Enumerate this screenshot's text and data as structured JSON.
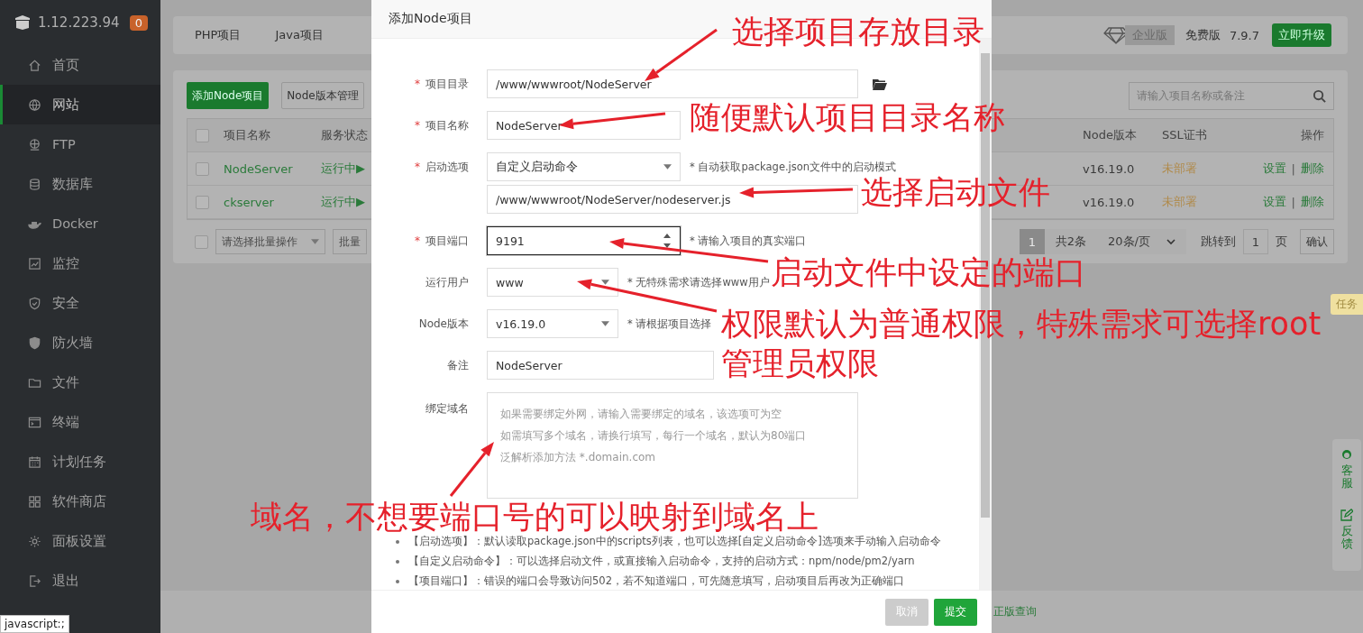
{
  "sidebar": {
    "host": "1.12.223.94",
    "badge": "0",
    "items": [
      {
        "label": "首页",
        "selected": false
      },
      {
        "label": "网站",
        "selected": true
      },
      {
        "label": "FTP",
        "selected": false
      },
      {
        "label": "数据库",
        "selected": false
      },
      {
        "label": "Docker",
        "selected": false
      },
      {
        "label": "监控",
        "selected": false
      },
      {
        "label": "安全",
        "selected": false
      },
      {
        "label": "防火墙",
        "selected": false
      },
      {
        "label": "文件",
        "selected": false
      },
      {
        "label": "终端",
        "selected": false
      },
      {
        "label": "计划任务",
        "selected": false
      },
      {
        "label": "软件商店",
        "selected": false
      },
      {
        "label": "面板设置",
        "selected": false
      },
      {
        "label": "退出",
        "selected": false
      }
    ]
  },
  "tabs": [
    {
      "label": "PHP项目",
      "selected": false
    },
    {
      "label": "Java项目",
      "selected": false
    }
  ],
  "edition": {
    "badge": "企业版",
    "plan": "免费版",
    "version": "7.9.7",
    "upgrade": "立即升级"
  },
  "toolbar": {
    "add": "添加Node项目",
    "manager": "Node版本管理",
    "search_placeholder": "请输入项目名称或备注"
  },
  "table": {
    "header_checked": false,
    "columns_left": [
      "项目名称",
      "服务状态"
    ],
    "columns_right": [
      "Node版本",
      "SSL证书",
      "操作"
    ],
    "rows": [
      {
        "checked": false,
        "name": "NodeServer",
        "status": "运行中▶",
        "version": "v16.19.0",
        "ssl": "未部署",
        "actions": [
          "设置",
          "|",
          "删除"
        ]
      },
      {
        "checked": false,
        "name": "ckserver",
        "status": "运行中▶",
        "version": "v16.19.0",
        "ssl": "未部署",
        "actions": [
          "设置",
          "|",
          "删除"
        ]
      }
    ]
  },
  "batch": {
    "checked": false,
    "select_placeholder": "请选择批量操作",
    "button": "批量"
  },
  "pagination": {
    "current": "1",
    "total": "共2条",
    "page_size": "20条/页",
    "jump_label": "跳转到",
    "jump_value": "1",
    "page_unit": "页",
    "confirm": "确认"
  },
  "float_panel": {
    "task": "任务",
    "items": [
      "客服",
      "反馈"
    ]
  },
  "footer_link": "正版查询",
  "status_tooltip": "javascript:;",
  "modal": {
    "title": "添加Node项目",
    "fields": [
      {
        "kind": "path",
        "required_mark": "*",
        "label": "项目目录",
        "value": "/www/wwwroot/NodeServer"
      },
      {
        "kind": "text",
        "required_mark": "*",
        "label": "项目名称",
        "value": "NodeServer"
      },
      {
        "kind": "select",
        "required_mark": "*",
        "label": "启动选项",
        "value": "自定义启动命令",
        "hint": "* 自动获取package.json文件中的启动模式"
      },
      {
        "kind": "text",
        "value": "/www/wwwroot/NodeServer/nodeserver.js"
      },
      {
        "kind": "number",
        "required_mark": "*",
        "label": "项目端口",
        "value": "9191",
        "focused": true,
        "hint": "* 请输入项目的真实端口"
      },
      {
        "kind": "select",
        "label": "运行用户",
        "value": "www",
        "hint": "* 无特殊需求请选择www用户"
      },
      {
        "kind": "select",
        "label": "Node版本",
        "value": "v16.19.0",
        "hint": "* 请根据项目选择"
      },
      {
        "kind": "text",
        "label": "备注",
        "value": "NodeServer"
      },
      {
        "kind": "textarea",
        "label": "绑定域名",
        "placeholder_lines": [
          "如果需要绑定外网，请输入需要绑定的域名，该选项可为空",
          "如需填写多个域名，请换行填写，每行一个域名，默认为80端口",
          "泛解析添加方法 *.domain.com"
        ]
      }
    ],
    "notes": [
      "【启动选项】：默认读取package.json中的scripts列表，也可以选择[自定义启动命令]选项来手动输入启动命令",
      "【自定义启动命令】：可以选择启动文件，或直接输入启动命令，支持的启动方式：npm/node/pm2/yarn",
      "【项目端口】：错误的端口会导致访问502，若不知道端口，可先随意填写，启动项目后再改为正确端口"
    ],
    "buttons": [
      {
        "label": "取消",
        "kind": "secondary"
      },
      {
        "label": "提交",
        "kind": "primary"
      }
    ]
  },
  "annotations": [
    {
      "lines": [
        "选择项目存放目录"
      ]
    },
    {
      "lines": [
        "随便默认项目目录名称"
      ]
    },
    {
      "lines": [
        "选择启动文件"
      ]
    },
    {
      "lines": [
        "启动文件中设定的端口"
      ]
    },
    {
      "lines": [
        "权限默认为普通权限，特殊需求可选择root",
        "管理员权限"
      ]
    },
    {
      "lines": [
        "域名，不想要端口号的可以映射到域名上"
      ]
    }
  ]
}
